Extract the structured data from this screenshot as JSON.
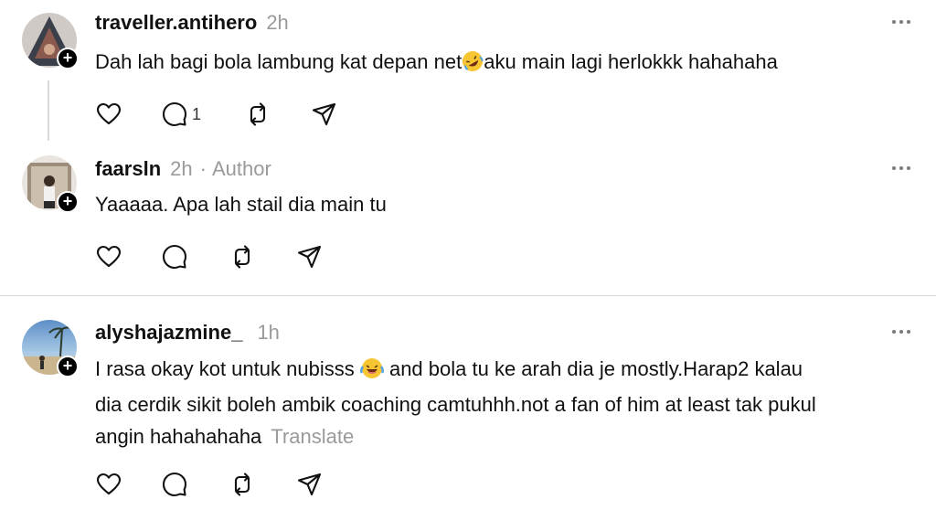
{
  "posts": [
    {
      "username": "traveller.antihero",
      "time": "2h",
      "text_before": "Dah lah bagi bola lambung kat depan net",
      "emoji_icon": "rolling-on-floor-laughing-emoji",
      "text_after": "aku main lagi herlokkk hahahaha",
      "reply_count": "1"
    },
    {
      "username": "faarsln",
      "time": "2h",
      "separator": "·",
      "author_label": "Author",
      "text": "Yaaaaa. Apa lah stail dia main tu"
    },
    {
      "username": "alyshajazmine_",
      "time": "1h",
      "line1_before": "I rasa okay kot untuk nubisss",
      "emoji_icon": "laughing-tears-emoji",
      "line1_after": "and bola tu ke arah dia je mostly.Harap2 kalau",
      "line2": "dia cerdik sikit boleh ambik coaching camtuhhh.not a fan of him at least tak pukul",
      "line3": "angin hahahahaha",
      "translate_label": "Translate"
    }
  ],
  "icons": [
    "heart-icon",
    "comment-icon",
    "repost-icon",
    "share-icon",
    "more-icon",
    "follow-plus-icon"
  ],
  "colors": {
    "text": "#111111",
    "muted": "#9a9a9a",
    "divider": "#d7d7d7",
    "thread_line": "#d9d9d9"
  }
}
